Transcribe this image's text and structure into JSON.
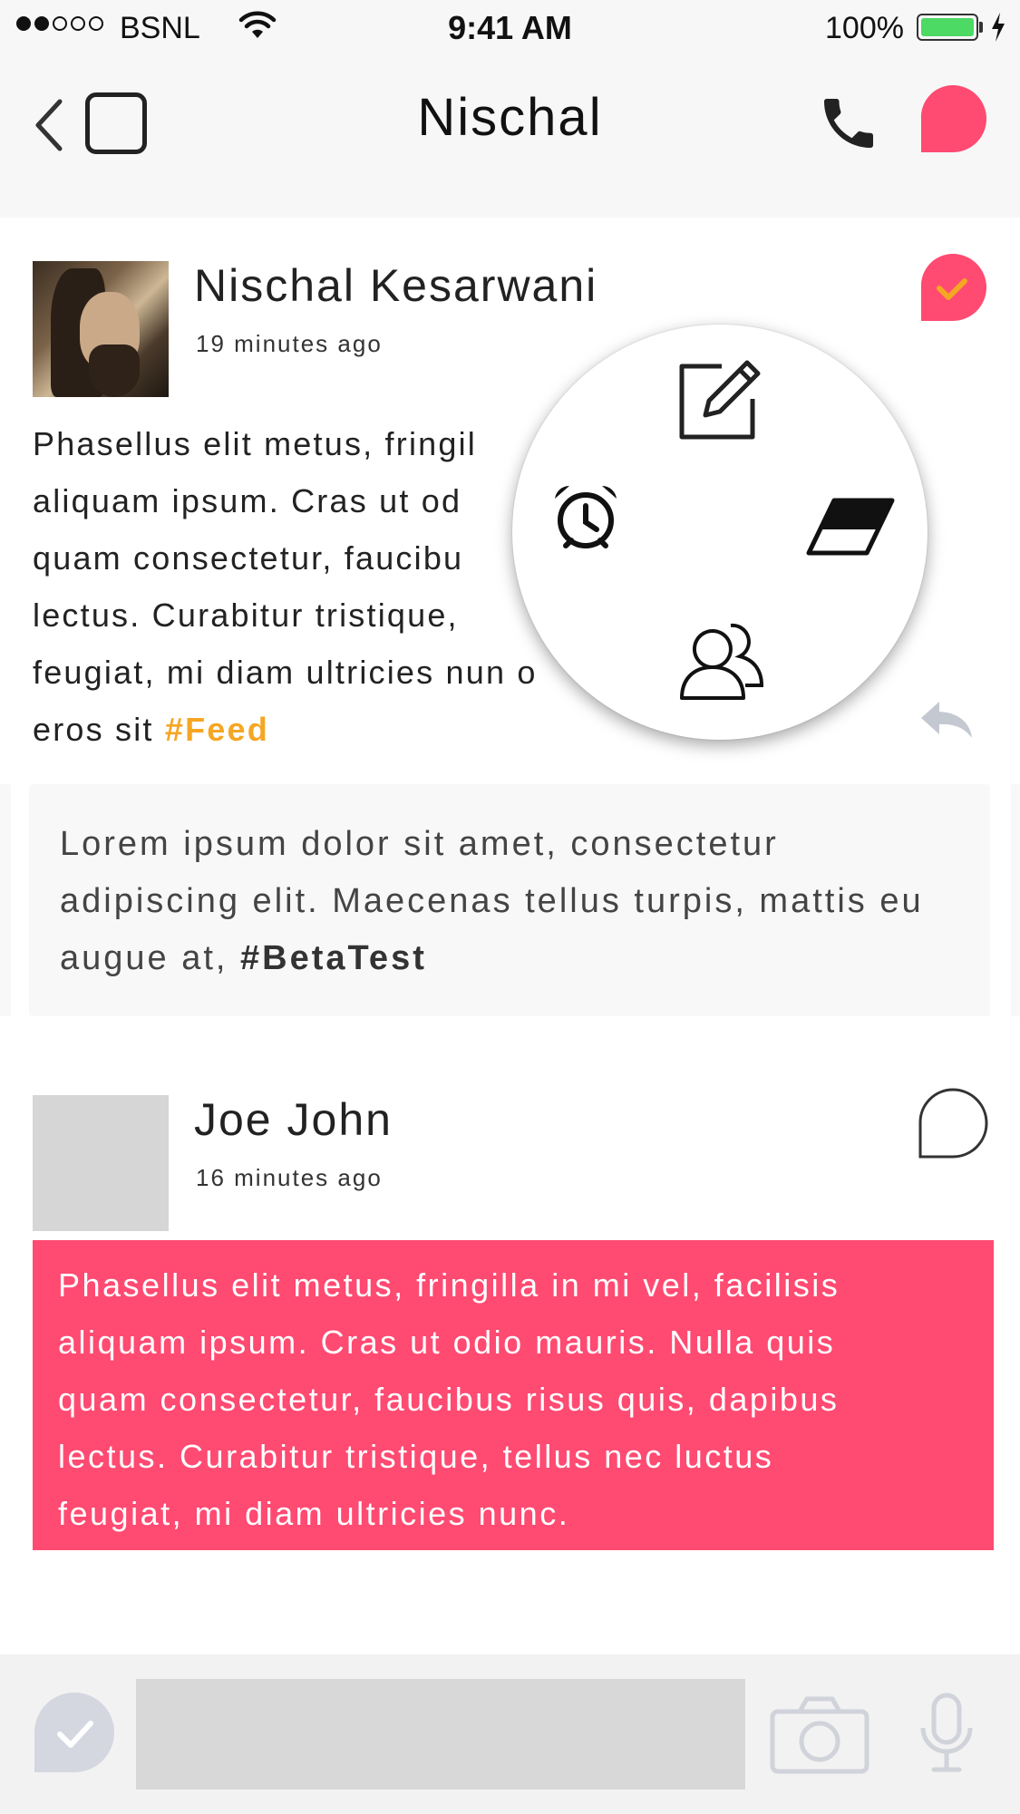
{
  "status_bar": {
    "carrier": "BSNL",
    "time": "9:41 AM",
    "battery": "100%",
    "signal_bars_filled": 2,
    "signal_bars_total": 5
  },
  "nav": {
    "title": "Nischal",
    "icons": [
      "chevron-left-icon",
      "square-icon",
      "phone-icon",
      "chat-bubble-icon"
    ]
  },
  "posts": [
    {
      "author": "Nischal Kesarwani",
      "time": "19 minutes ago",
      "body": "Phasellus elit metus, fringil\naliquam ipsum. Cras ut od\nquam consectetur, faucibu\nlectus. Curabitur tristique,\nfeugiat, mi diam ultricies nun                    o\neros sit ",
      "hashtag": "#Feed",
      "quote": {
        "text": "Lorem ipsum dolor sit amet, consectetur adipiscing elit. Maecenas tellus turpis, mattis eu augue at, ",
        "hashtag": "#BetaTest"
      }
    },
    {
      "author": "Joe John",
      "time": "16 minutes ago",
      "body": "Phasellus elit metus, fringilla in mi vel, facilisis\naliquam ipsum.  Cras ut odio mauris. Nulla quis\nquam consectetur, faucibus risus quis, dapibus\nlectus. Curabitur tristique, tellus nec luctus\nfeugiat, mi diam ultricies nunc."
    }
  ],
  "radial_menu": {
    "items": [
      "edit-icon",
      "alarm-icon",
      "eraser-icon",
      "people-icon"
    ]
  },
  "colors": {
    "accent_pink": "#ff4a72",
    "hashtag_orange": "#f5a623",
    "battery_green": "#4cd964"
  }
}
